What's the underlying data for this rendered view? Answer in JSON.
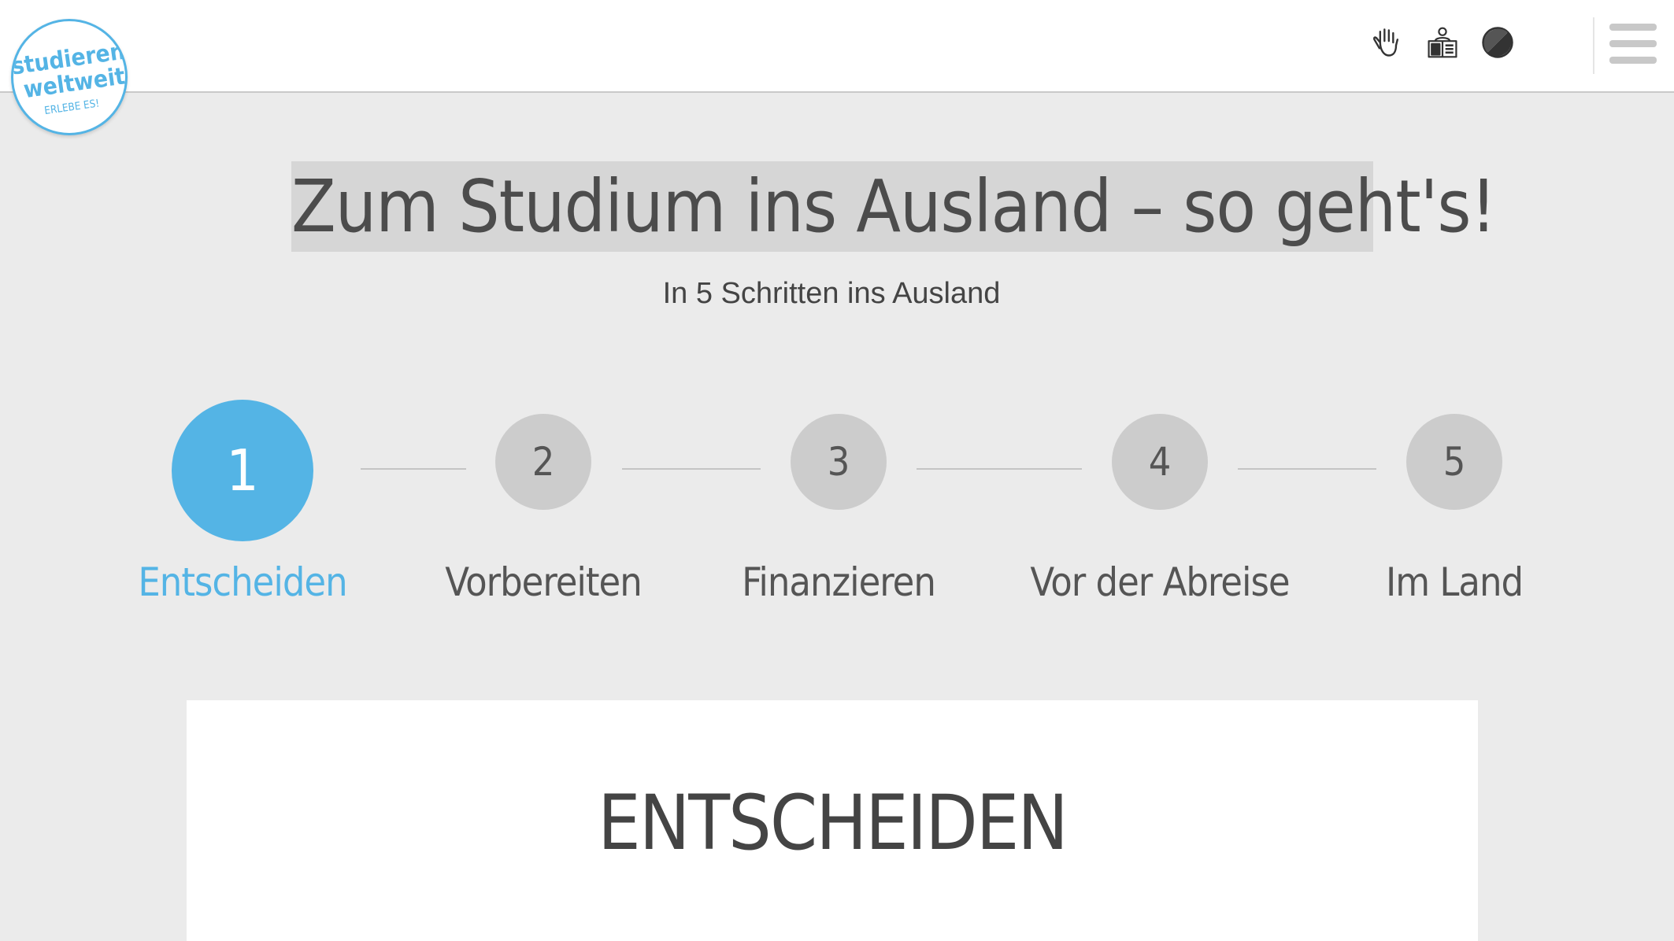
{
  "header": {
    "logo": {
      "line1": "studieren",
      "line2": "weltweit",
      "line3": "ERLEBE ES!"
    },
    "tools": [
      {
        "icon": "sign-language-hand-icon"
      },
      {
        "icon": "easy-language-book-icon"
      },
      {
        "icon": "contrast-icon"
      }
    ],
    "menu_icon": "hamburger-menu-icon"
  },
  "hero": {
    "title": "Zum Studium ins Ausland – so geht's!",
    "subtitle": "In 5 Schritten ins Ausland"
  },
  "steps": [
    {
      "number": "1",
      "label": "Entscheiden",
      "active": true
    },
    {
      "number": "2",
      "label": "Vorbereiten",
      "active": false
    },
    {
      "number": "3",
      "label": "Finanzieren",
      "active": false
    },
    {
      "number": "4",
      "label": "Vor der Abreise",
      "active": false
    },
    {
      "number": "5",
      "label": "Im Land",
      "active": false
    }
  ],
  "card": {
    "title": "ENTSCHEIDEN"
  },
  "colors": {
    "accent": "#54b4e5",
    "inactive_circle": "#cccccc",
    "page_background": "#ebebeb",
    "text": "#4c4c4c"
  }
}
